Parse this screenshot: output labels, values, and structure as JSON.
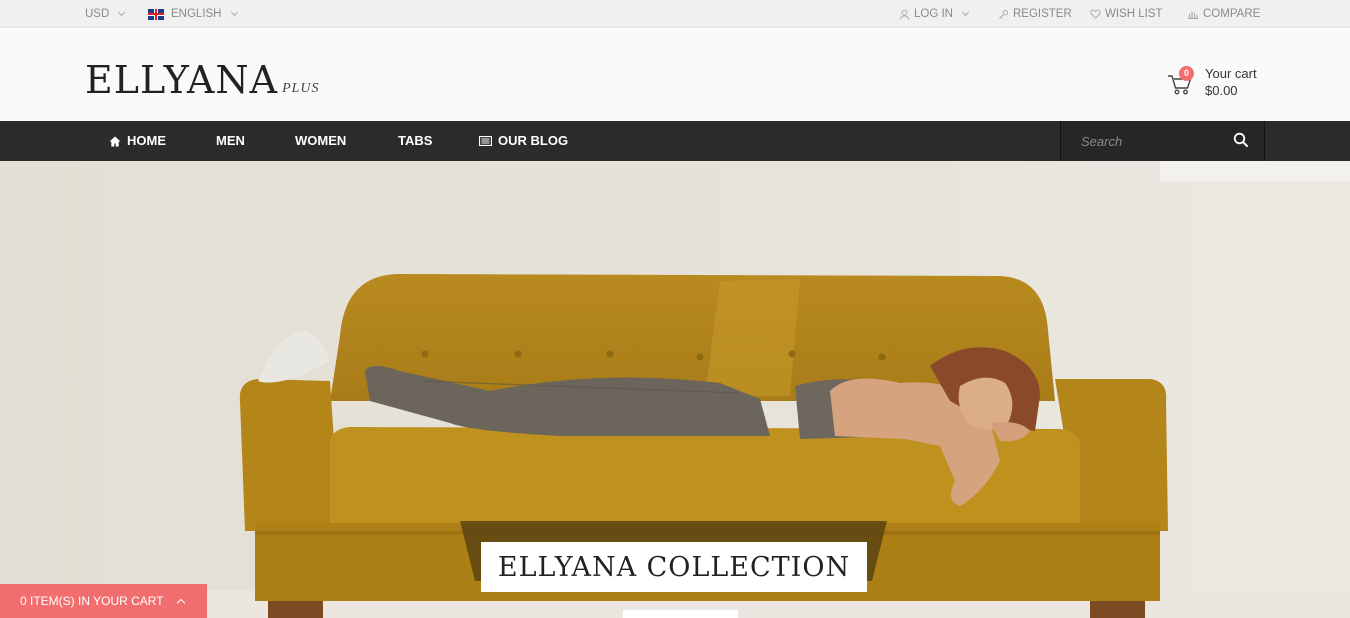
{
  "topbar": {
    "currency": "USD",
    "language": "ENGLISH",
    "login": "LOG IN",
    "register": "REGISTER",
    "wishlist": "WISH LIST",
    "compare": "COMPARE"
  },
  "header": {
    "logo_main": "ELLYANA",
    "logo_sub": "PLUS",
    "cart_count": "0",
    "cart_label": "Your cart",
    "cart_total": "$0.00"
  },
  "nav": {
    "items": [
      {
        "label": "HOME",
        "icon": "home-icon"
      },
      {
        "label": "MEN"
      },
      {
        "label": "WOMEN"
      },
      {
        "label": "TABS"
      },
      {
        "label": "OUR BLOG",
        "icon": "blog-icon"
      }
    ],
    "search_placeholder": "Search"
  },
  "hero": {
    "title": "ELLYANA COLLECTION"
  },
  "cartbar": {
    "label": "0 ITEM(S) IN YOUR CART"
  },
  "colors": {
    "accent": "#f26d6d",
    "nav_bg": "#2b2b2b",
    "sofa": "#b98a1e"
  }
}
